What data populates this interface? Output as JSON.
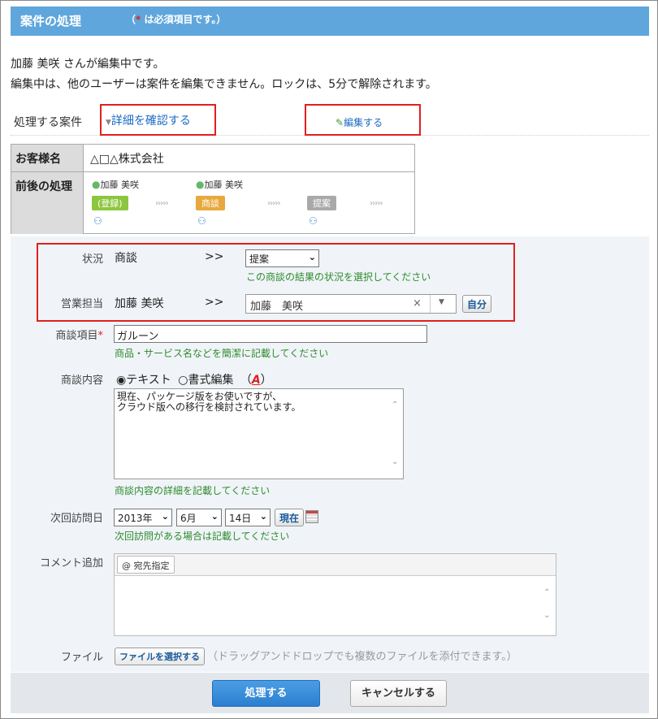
{
  "header": {
    "title": "案件の処理",
    "note_star": "*",
    "note_text": " は必須項目です。）",
    "note_open": "（"
  },
  "messages": {
    "line1": "加藤 美咲 さんが編集中です。",
    "line2": "編集中は、他のユーザーは案件を編集できません。ロックは、5分で解除されます。"
  },
  "case": {
    "label": "処理する案件",
    "detail_link": "詳細を確認する",
    "edit_link": "編集する"
  },
  "info_table": {
    "customer_label": "お客様名",
    "customer_value": "△□△株式会社",
    "flow_label": "前後の処理",
    "persons": [
      "加藤 美咲",
      "加藤 美咲"
    ],
    "stages": [
      {
        "label": "(登録)",
        "color": "#8cc63f"
      },
      {
        "label": "商談",
        "color": "#e8a83c"
      },
      {
        "label": "提案",
        "color": "#a9a9a9"
      }
    ],
    "chevrons": "›››››"
  },
  "form": {
    "status": {
      "label": "状況",
      "current": "商談",
      "arrow": ">>",
      "selected": "提案",
      "hint": "この商談の結果の状況を選択してください"
    },
    "sales_rep": {
      "label": "営業担当",
      "current": "加藤 美咲",
      "arrow": ">>",
      "value": "加藤　美咲",
      "clear": "×",
      "self_button": "自分"
    },
    "item": {
      "label": "商談項目",
      "required_mark": "*",
      "value": "ガルーン",
      "hint": "商品・サービス名などを簡潔に記載してください"
    },
    "content": {
      "label": "商談内容",
      "radio_text": "◉テキスト",
      "radio_rich": "○書式編集",
      "font_open": "（",
      "font_icon": "A",
      "font_close": "）",
      "value": "現在、パッケージ版をお使いですが、\nクラウド版への移行を検討されています。",
      "hint": "商談内容の詳細を記載してください"
    },
    "next_visit": {
      "label": "次回訪問日",
      "year": "2013年",
      "month": "6月",
      "day": "14日",
      "now_button": "現在",
      "hint": "次回訪問がある場合は記載してください"
    },
    "comment": {
      "label": "コメント追加",
      "address_button": "@ 宛先指定"
    },
    "file": {
      "label": "ファイル",
      "select_button": "ファイルを選択する",
      "note": "（ドラッグアンドドロップでも複数のファイルを添付できます。）"
    }
  },
  "footer": {
    "submit": "処理する",
    "cancel": "キャンセルする"
  },
  "colors": {
    "header_bg": "#5fa6dc",
    "highlight_border": "#e02020",
    "hint_text": "#2e8b2e",
    "link": "#1a6bc4"
  }
}
